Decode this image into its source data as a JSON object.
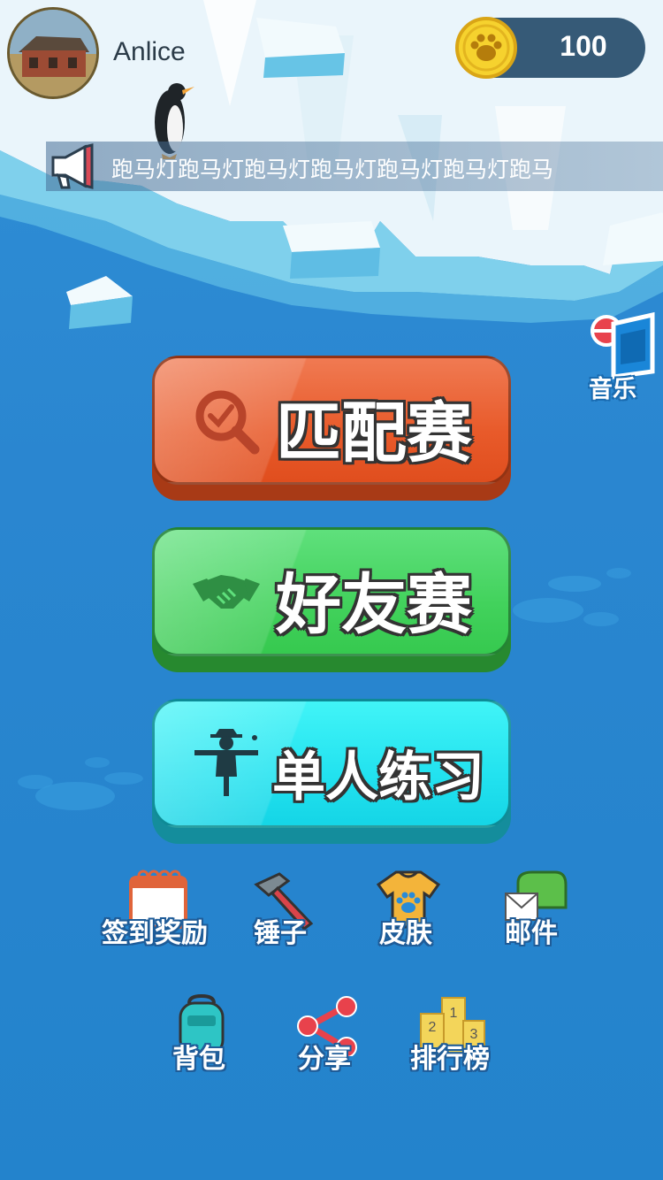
{
  "player": {
    "name": "Anlice",
    "coins": "100"
  },
  "marquee": {
    "text": "跑马灯跑马灯跑马灯跑马灯跑马灯跑马灯跑马"
  },
  "music": {
    "label": "音乐"
  },
  "main_buttons": {
    "match": "匹配赛",
    "friend": "好友赛",
    "solo": "单人练习"
  },
  "menu_row1": [
    {
      "label": "签到奖励",
      "icon": "calendar-icon"
    },
    {
      "label": "锤子",
      "icon": "hammer-icon"
    },
    {
      "label": "皮肤",
      "icon": "tshirt-icon"
    },
    {
      "label": "邮件",
      "icon": "mailbox-icon"
    }
  ],
  "menu_row2": [
    {
      "label": "背包",
      "icon": "backpack-icon"
    },
    {
      "label": "分享",
      "icon": "share-icon"
    },
    {
      "label": "排行榜",
      "icon": "podium-icon"
    }
  ],
  "podium_numbers": [
    "1",
    "2",
    "3"
  ],
  "colors": {
    "match": "#e85a2a",
    "friend": "#42d25c",
    "solo": "#22e2ef",
    "sea": "#2a86d0"
  }
}
